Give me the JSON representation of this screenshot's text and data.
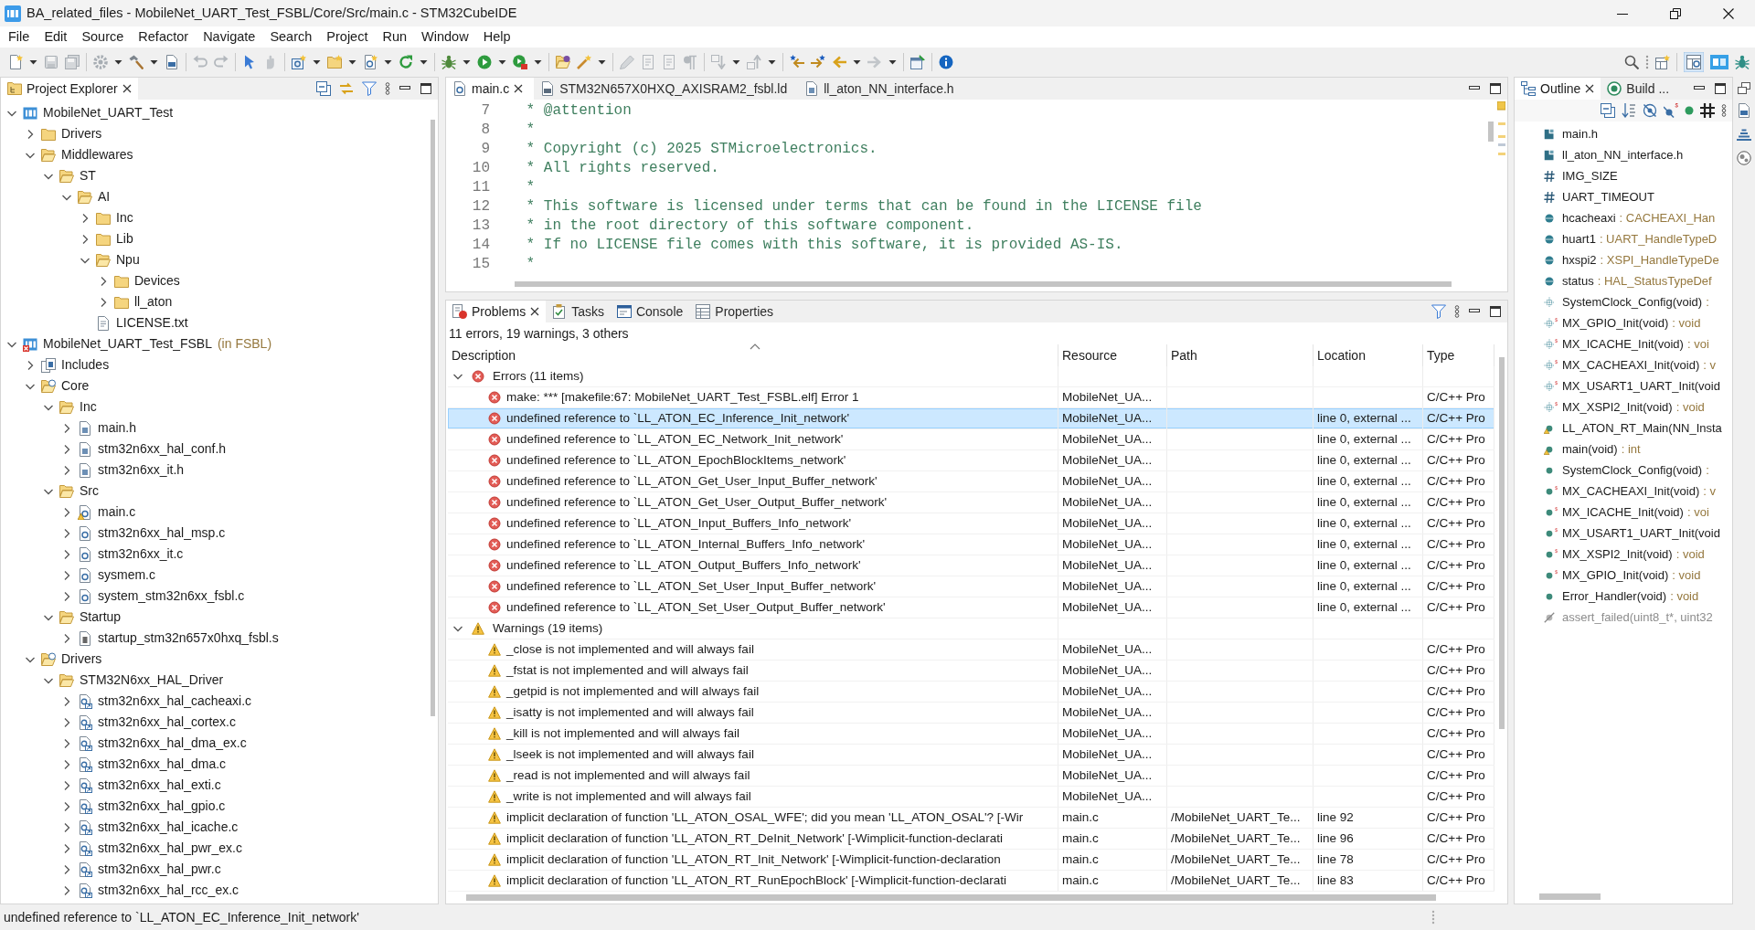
{
  "window": {
    "title": "BA_related_files - MobileNet_UART_Test_FSBL/Core/Src/main.c - STM32CubeIDE"
  },
  "menu": [
    "File",
    "Edit",
    "Source",
    "Refactor",
    "Navigate",
    "Search",
    "Project",
    "Run",
    "Window",
    "Help"
  ],
  "project_explorer": {
    "tabs": [
      {
        "label": "Project Explorer",
        "kind": "explorer",
        "selected": true
      }
    ],
    "tree": [
      {
        "label": "MobileNet_UART_Test",
        "kind": "project",
        "expanded": true,
        "children": [
          {
            "label": "Drivers",
            "kind": "folder",
            "expanded": false
          },
          {
            "label": "Middlewares",
            "kind": "folder",
            "expanded": true,
            "children": [
              {
                "label": "ST",
                "kind": "folder",
                "expanded": true,
                "children": [
                  {
                    "label": "AI",
                    "kind": "folder",
                    "expanded": true,
                    "children": [
                      {
                        "label": "Inc",
                        "kind": "folder",
                        "expanded": false
                      },
                      {
                        "label": "Lib",
                        "kind": "folder",
                        "expanded": false
                      },
                      {
                        "label": "Npu",
                        "kind": "folder",
                        "expanded": true,
                        "children": [
                          {
                            "label": "Devices",
                            "kind": "folder",
                            "expanded": false
                          },
                          {
                            "label": "ll_aton",
                            "kind": "folder",
                            "expanded": false
                          }
                        ]
                      },
                      {
                        "label": "LICENSE.txt",
                        "kind": "text"
                      }
                    ]
                  }
                ]
              }
            ]
          }
        ]
      },
      {
        "label": "MobileNet_UART_Test_FSBL",
        "suffix": "(in FSBL)",
        "kind": "project",
        "error": true,
        "expanded": true,
        "children": [
          {
            "label": "Includes",
            "kind": "includes",
            "expanded": false
          },
          {
            "label": "Core",
            "kind": "source-folder",
            "expanded": true,
            "children": [
              {
                "label": "Inc",
                "kind": "folder",
                "expanded": true,
                "children": [
                  {
                    "label": "main.h",
                    "kind": "header",
                    "expanded": false
                  },
                  {
                    "label": "stm32n6xx_hal_conf.h",
                    "kind": "header",
                    "expanded": false
                  },
                  {
                    "label": "stm32n6xx_it.h",
                    "kind": "header",
                    "expanded": false
                  }
                ]
              },
              {
                "label": "Src",
                "kind": "folder",
                "expanded": true,
                "children": [
                  {
                    "label": "main.c",
                    "kind": "source",
                    "warning": true,
                    "expanded": false
                  },
                  {
                    "label": "stm32n6xx_hal_msp.c",
                    "kind": "source",
                    "expanded": false
                  },
                  {
                    "label": "stm32n6xx_it.c",
                    "kind": "source",
                    "expanded": false
                  },
                  {
                    "label": "sysmem.c",
                    "kind": "source",
                    "expanded": false
                  },
                  {
                    "label": "system_stm32n6xx_fsbl.c",
                    "kind": "source",
                    "expanded": false
                  }
                ]
              },
              {
                "label": "Startup",
                "kind": "folder",
                "expanded": true,
                "children": [
                  {
                    "label": "startup_stm32n657x0hxq_fsbl.s",
                    "kind": "asm",
                    "expanded": false
                  }
                ]
              }
            ]
          },
          {
            "label": "Drivers",
            "kind": "source-folder",
            "expanded": true,
            "children": [
              {
                "label": "STM32N6xx_HAL_Driver",
                "kind": "folder",
                "expanded": true,
                "children": [
                  {
                    "label": "stm32n6xx_hal_cacheaxi.c",
                    "kind": "linked-source",
                    "expanded": false
                  },
                  {
                    "label": "stm32n6xx_hal_cortex.c",
                    "kind": "linked-source",
                    "expanded": false
                  },
                  {
                    "label": "stm32n6xx_hal_dma_ex.c",
                    "kind": "linked-source",
                    "expanded": false
                  },
                  {
                    "label": "stm32n6xx_hal_dma.c",
                    "kind": "linked-source",
                    "expanded": false
                  },
                  {
                    "label": "stm32n6xx_hal_exti.c",
                    "kind": "linked-source",
                    "expanded": false
                  },
                  {
                    "label": "stm32n6xx_hal_gpio.c",
                    "kind": "linked-source",
                    "expanded": false
                  },
                  {
                    "label": "stm32n6xx_hal_icache.c",
                    "kind": "linked-source",
                    "expanded": false
                  },
                  {
                    "label": "stm32n6xx_hal_pwr_ex.c",
                    "kind": "linked-source",
                    "expanded": false
                  },
                  {
                    "label": "stm32n6xx_hal_pwr.c",
                    "kind": "linked-source",
                    "expanded": false
                  },
                  {
                    "label": "stm32n6xx_hal_rcc_ex.c",
                    "kind": "linked-source",
                    "expanded": false
                  }
                ]
              }
            ]
          }
        ]
      }
    ]
  },
  "editor": {
    "tabs": [
      {
        "label": "main.c",
        "kind": "source",
        "selected": true
      },
      {
        "label": "STM32N657X0HXQ_AXISRAM2_fsbl.ld",
        "kind": "linker",
        "selected": false
      },
      {
        "label": "ll_aton_NN_interface.h",
        "kind": "header",
        "selected": false
      }
    ],
    "lines": [
      {
        "number": "7",
        "text": " * @attention"
      },
      {
        "number": "8",
        "text": " *"
      },
      {
        "number": "9",
        "text": " * Copyright (c) 2025 STMicroelectronics."
      },
      {
        "number": "10",
        "text": " * All rights reserved."
      },
      {
        "number": "11",
        "text": " *"
      },
      {
        "number": "12",
        "text": " * This software is licensed under terms that can be found in the LICENSE file"
      },
      {
        "number": "13",
        "text": " * in the root directory of this software component."
      },
      {
        "number": "14",
        "text": " * If no LICENSE file comes with this software, it is provided AS-IS."
      },
      {
        "number": "15",
        "text": " *"
      }
    ]
  },
  "problems": {
    "tabs": [
      {
        "label": "Problems",
        "kind": "problems",
        "selected": true
      },
      {
        "label": "Tasks",
        "kind": "tasks",
        "selected": false
      },
      {
        "label": "Console",
        "kind": "console",
        "selected": false
      },
      {
        "label": "Properties",
        "kind": "properties",
        "selected": false
      }
    ],
    "summary": "11 errors, 19 warnings, 3 others",
    "columns": [
      "Description",
      "Resource",
      "Path",
      "Location",
      "Type"
    ],
    "groups": [
      {
        "kind": "error",
        "label": "Errors (11 items)",
        "expanded": true,
        "rows": [
          {
            "description": "make: *** [makefile:67: MobileNet_UART_Test_FSBL.elf] Error 1",
            "resource": "MobileNet_UA...",
            "type": "C/C++ Pro",
            "selected": false
          },
          {
            "description": "undefined reference to `LL_ATON_EC_Inference_Init_network'",
            "resource": "MobileNet_UA...",
            "location": "line 0, external ...",
            "type": "C/C++ Pro",
            "selected": true
          },
          {
            "description": "undefined reference to `LL_ATON_EC_Network_Init_network'",
            "resource": "MobileNet_UA...",
            "location": "line 0, external ...",
            "type": "C/C++ Pro",
            "selected": false
          },
          {
            "description": "undefined reference to `LL_ATON_EpochBlockItems_network'",
            "resource": "MobileNet_UA...",
            "location": "line 0, external ...",
            "type": "C/C++ Pro",
            "selected": false
          },
          {
            "description": "undefined reference to `LL_ATON_Get_User_Input_Buffer_network'",
            "resource": "MobileNet_UA...",
            "location": "line 0, external ...",
            "type": "C/C++ Pro",
            "selected": false
          },
          {
            "description": "undefined reference to `LL_ATON_Get_User_Output_Buffer_network'",
            "resource": "MobileNet_UA...",
            "location": "line 0, external ...",
            "type": "C/C++ Pro",
            "selected": false
          },
          {
            "description": "undefined reference to `LL_ATON_Input_Buffers_Info_network'",
            "resource": "MobileNet_UA...",
            "location": "line 0, external ...",
            "type": "C/C++ Pro",
            "selected": false
          },
          {
            "description": "undefined reference to `LL_ATON_Internal_Buffers_Info_network'",
            "resource": "MobileNet_UA...",
            "location": "line 0, external ...",
            "type": "C/C++ Pro",
            "selected": false
          },
          {
            "description": "undefined reference to `LL_ATON_Output_Buffers_Info_network'",
            "resource": "MobileNet_UA...",
            "location": "line 0, external ...",
            "type": "C/C++ Pro",
            "selected": false
          },
          {
            "description": "undefined reference to `LL_ATON_Set_User_Input_Buffer_network'",
            "resource": "MobileNet_UA...",
            "location": "line 0, external ...",
            "type": "C/C++ Pro",
            "selected": false
          },
          {
            "description": "undefined reference to `LL_ATON_Set_User_Output_Buffer_network'",
            "resource": "MobileNet_UA...",
            "location": "line 0, external ...",
            "type": "C/C++ Pro",
            "selected": false
          }
        ]
      },
      {
        "kind": "warning",
        "label": "Warnings (19 items)",
        "expanded": true,
        "rows": [
          {
            "description": "_close is not implemented and will always fail",
            "resource": "MobileNet_UA...",
            "type": "C/C++ Pro",
            "selected": false
          },
          {
            "description": "_fstat is not implemented and will always fail",
            "resource": "MobileNet_UA...",
            "type": "C/C++ Pro",
            "selected": false
          },
          {
            "description": "_getpid is not implemented and will always fail",
            "resource": "MobileNet_UA...",
            "type": "C/C++ Pro",
            "selected": false
          },
          {
            "description": "_isatty is not implemented and will always fail",
            "resource": "MobileNet_UA...",
            "type": "C/C++ Pro",
            "selected": false
          },
          {
            "description": "_kill is not implemented and will always fail",
            "resource": "MobileNet_UA...",
            "type": "C/C++ Pro",
            "selected": false
          },
          {
            "description": "_lseek is not implemented and will always fail",
            "resource": "MobileNet_UA...",
            "type": "C/C++ Pro",
            "selected": false
          },
          {
            "description": "_read is not implemented and will always fail",
            "resource": "MobileNet_UA...",
            "type": "C/C++ Pro",
            "selected": false
          },
          {
            "description": "_write is not implemented and will always fail",
            "resource": "MobileNet_UA...",
            "type": "C/C++ Pro",
            "selected": false
          },
          {
            "description": "implicit declaration of function 'LL_ATON_OSAL_WFE'; did you mean 'LL_ATON_OSAL'? [-Wir",
            "resource": "main.c",
            "path": "/MobileNet_UART_Te...",
            "location": "line 92",
            "type": "C/C++ Pro",
            "selected": false
          },
          {
            "description": "implicit declaration of function 'LL_ATON_RT_DeInit_Network' [-Wimplicit-function-declarati",
            "resource": "main.c",
            "path": "/MobileNet_UART_Te...",
            "location": "line 96",
            "type": "C/C++ Pro",
            "selected": false
          },
          {
            "description": "implicit declaration of function 'LL_ATON_RT_Init_Network' [-Wimplicit-function-declaration",
            "resource": "main.c",
            "path": "/MobileNet_UART_Te...",
            "location": "line 78",
            "type": "C/C++ Pro",
            "selected": false
          },
          {
            "description": "implicit declaration of function 'LL_ATON_RT_RunEpochBlock' [-Wimplicit-function-declarati",
            "resource": "main.c",
            "path": "/MobileNet_UART_Te...",
            "location": "line 83",
            "type": "C/C++ Pro",
            "selected": false
          }
        ]
      }
    ]
  },
  "outline": {
    "tabs": [
      {
        "label": "Outline",
        "kind": "outline",
        "selected": true
      },
      {
        "label": "Build ...",
        "kind": "build",
        "selected": false
      }
    ],
    "items": [
      {
        "kind": "include",
        "name": "main.h",
        "static": false,
        "warning": false
      },
      {
        "kind": "include",
        "name": "ll_aton_NN_interface.h",
        "static": false,
        "warning": false
      },
      {
        "kind": "macro",
        "name": "IMG_SIZE",
        "static": false,
        "warning": false
      },
      {
        "kind": "macro",
        "name": "UART_TIMEOUT",
        "static": false,
        "warning": false
      },
      {
        "kind": "variable",
        "name": "hcacheaxi",
        "type": ": CACHEAXI_Han",
        "static": false,
        "warning": false
      },
      {
        "kind": "variable",
        "name": "huart1",
        "type": ": UART_HandleTypeD",
        "static": false,
        "warning": false
      },
      {
        "kind": "variable",
        "name": "hxspi2",
        "type": ": XSPI_HandleTypeDe",
        "static": false,
        "warning": false
      },
      {
        "kind": "variable",
        "name": "status",
        "type": ": HAL_StatusTypeDef",
        "static": false,
        "warning": false
      },
      {
        "kind": "declaration",
        "name": "SystemClock_Config(void)",
        "type": ":",
        "static": false,
        "warning": false
      },
      {
        "kind": "declaration",
        "name": "MX_GPIO_Init(void)",
        "type": ": void",
        "static": true,
        "warning": false
      },
      {
        "kind": "declaration",
        "name": "MX_ICACHE_Init(void)",
        "type": ": voi",
        "static": true,
        "warning": false
      },
      {
        "kind": "declaration",
        "name": "MX_CACHEAXI_Init(void)",
        "type": ": v",
        "static": true,
        "warning": false
      },
      {
        "kind": "declaration",
        "name": "MX_USART1_UART_Init(void",
        "static": true,
        "warning": false
      },
      {
        "kind": "declaration",
        "name": "MX_XSPI2_Init(void)",
        "type": ": void",
        "static": true,
        "warning": false
      },
      {
        "kind": "function",
        "name": "LL_ATON_RT_Main(NN_Insta",
        "static": false,
        "warning": true
      },
      {
        "kind": "function",
        "name": "main(void)",
        "type": ": int",
        "static": false,
        "warning": true
      },
      {
        "kind": "function",
        "name": "SystemClock_Config(void)",
        "type": ":",
        "static": false,
        "warning": false
      },
      {
        "kind": "function",
        "name": "MX_CACHEAXI_Init(void)",
        "type": ": v",
        "static": true,
        "warning": false
      },
      {
        "kind": "function",
        "name": "MX_ICACHE_Init(void)",
        "type": ": voi",
        "static": true,
        "warning": false
      },
      {
        "kind": "function",
        "name": "MX_USART1_UART_Init(void",
        "static": true,
        "warning": false
      },
      {
        "kind": "function",
        "name": "MX_XSPI2_Init(void)",
        "type": ": void",
        "static": true,
        "warning": false
      },
      {
        "kind": "function",
        "name": "MX_GPIO_Init(void)",
        "type": ": void",
        "static": true,
        "warning": false
      },
      {
        "kind": "function",
        "name": "Error_Handler(void)",
        "type": ": void",
        "static": false,
        "warning": false
      },
      {
        "kind": "inactive",
        "name": "assert_failed(uint8_t*, uint32",
        "static": false,
        "warning": false
      }
    ]
  },
  "status_bar": {
    "text": "undefined reference to `LL_ATON_EC_Inference_Init_network'"
  }
}
